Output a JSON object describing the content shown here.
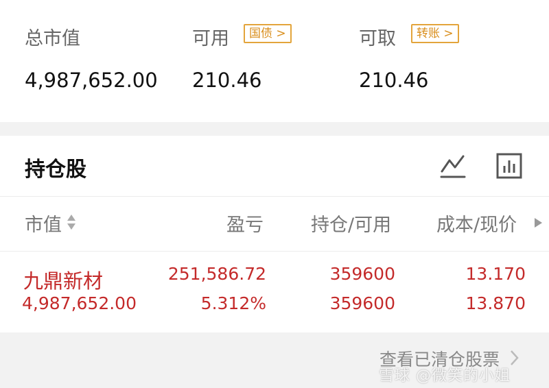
{
  "account": {
    "total_market_value_label": "总市值",
    "total_market_value": "4,987,652.00",
    "available_label": "可用",
    "available_tag": "国债",
    "available_value": "210.46",
    "withdrawable_label": "可取",
    "withdrawable_tag": "转账",
    "withdrawable_value": "210.46"
  },
  "holdings": {
    "title": "持仓股",
    "line_chart_icon": "line-chart-icon",
    "bar_chart_icon": "bar-chart-icon",
    "columns": {
      "market_value": "市值",
      "profit_loss": "盈亏",
      "position_available": "持仓/可用",
      "cost_price": "成本/现价"
    },
    "rows": [
      {
        "name": "九鼎新材",
        "market_value": "4,987,652.00",
        "profit_loss": "251,586.72",
        "profit_loss_pct": "5.312%",
        "position": "359600",
        "available": "359600",
        "cost": "13.170",
        "price": "13.870"
      }
    ],
    "view_cleared_label": "查看已清仓股票"
  },
  "watermark": "雪球 @微笑的小姐",
  "colors": {
    "accent_orange": "#e3a43b",
    "gain_red": "#c42a2a",
    "muted_gray": "#777777",
    "band_gray": "#f2f2f2"
  }
}
